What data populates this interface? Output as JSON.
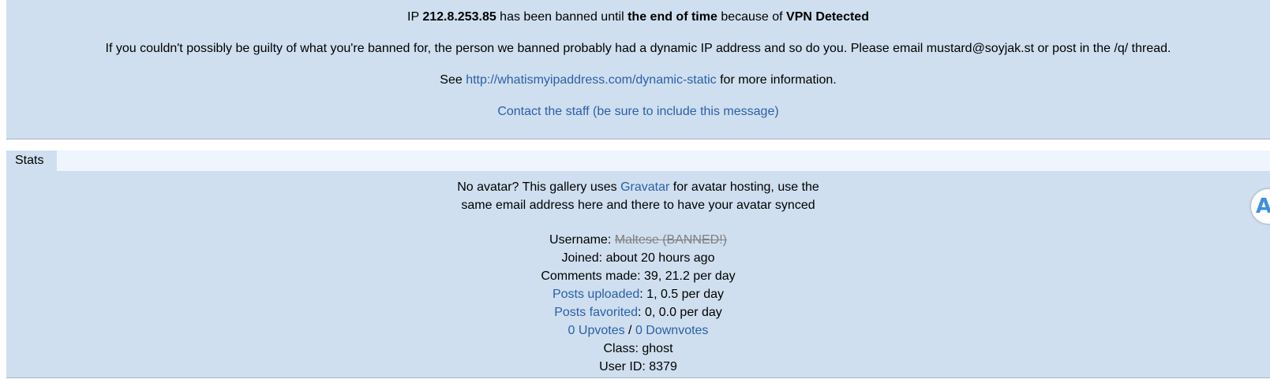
{
  "ban": {
    "line1": {
      "pre": "IP ",
      "ip": "212.8.253.85",
      "mid": " has been banned until ",
      "until": "the end of time",
      "because": " because of ",
      "reason": "VPN Detected"
    },
    "line2": "If you couldn't possibly be guilty of what you're banned for, the person we banned probably had a dynamic IP address and so do you. Please email mustard@soyjak.st or post in the /q/ thread.",
    "line3": {
      "pre": "See ",
      "link": "http://whatismyipaddress.com/dynamic-static",
      "post": " for more information."
    },
    "contact_link": "Contact the staff (be sure to include this message)"
  },
  "stats": {
    "tab_label": "Stats",
    "avatar_note": {
      "pre": "No avatar? This gallery uses ",
      "link": "Gravatar",
      "post1": " for avatar hosting, use the",
      "line2": "same email address here and there to have your avatar synced"
    },
    "username_label": "Username: ",
    "username_value": "Maltese (BANNED!)",
    "joined": "Joined: about 20 hours ago",
    "comments": "Comments made: 39, 21.2 per day",
    "posts_uploaded_link": "Posts uploaded",
    "posts_uploaded_value": ": 1, 0.5 per day",
    "posts_favorited_link": "Posts favorited",
    "posts_favorited_value": ": 0, 0.0 per day",
    "upvotes_link": "0 Upvotes",
    "vote_separator": " / ",
    "downvotes_link": "0 Downvotes",
    "class": "Class: ghost",
    "user_id": "User ID: 8379"
  },
  "side_badge": {
    "icon": "floating-extension-icon",
    "glyph": "A",
    "color": "#3d8fe0"
  }
}
